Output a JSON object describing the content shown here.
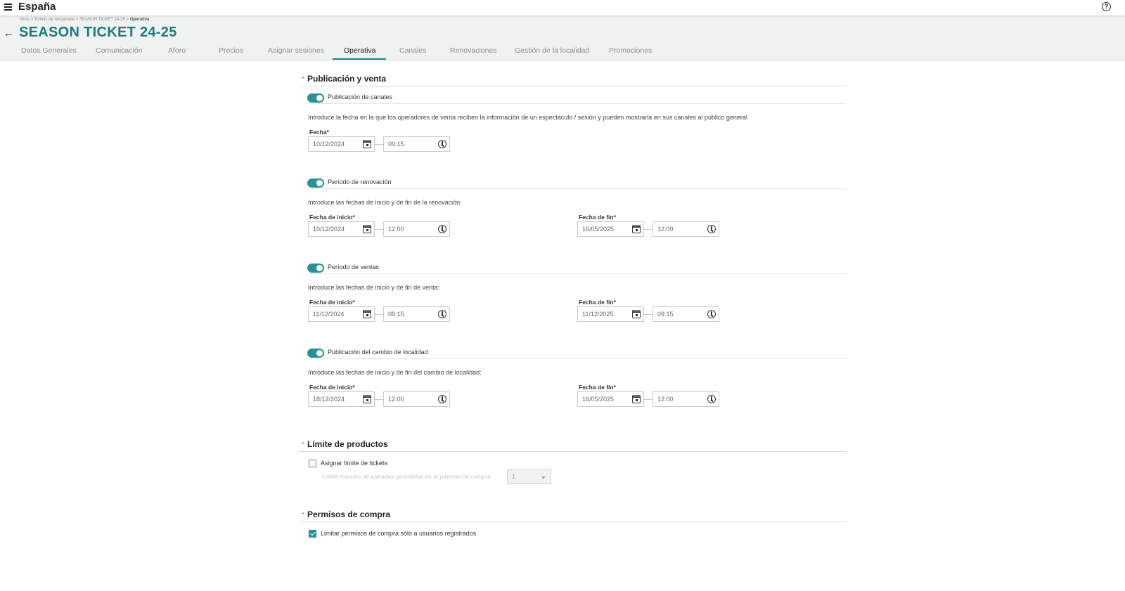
{
  "app": {
    "title": "España"
  },
  "breadcrumb": {
    "trail": "Inicio > Tickets de temporada > SEASON TICKET 24-25 > ",
    "current": "Operativa"
  },
  "page": {
    "title": "SEASON TICKET 24-25"
  },
  "tabs": [
    {
      "label": "Datos Generales",
      "active": false
    },
    {
      "label": "Comunicación",
      "active": false
    },
    {
      "label": "Aforo",
      "active": false
    },
    {
      "label": "Precios",
      "active": false
    },
    {
      "label": "Asignar sesiones",
      "active": false
    },
    {
      "label": "Operativa",
      "active": true
    },
    {
      "label": "Canales",
      "active": false
    },
    {
      "label": "Renovaciones",
      "active": false
    },
    {
      "label": "Gestión de la localidad",
      "active": false
    },
    {
      "label": "Promociones",
      "active": false
    }
  ],
  "sections": {
    "publicacion": {
      "title": "Publicación y venta",
      "canales": {
        "toggle_label": "Publicación de canales",
        "enabled": true,
        "description": "Introduce la fecha en la que los operadores de venta reciben la información de un espectáculo / sesión y pueden mostrarla en sus canales al público general",
        "fecha_label": "Fecha*",
        "date": "10/12/2024",
        "time": "09:15"
      },
      "renovacion": {
        "toggle_label": "Período de renovación",
        "enabled": true,
        "description": "Introduce las fechas de inicio y de fin de la renovación:",
        "start_label": "Fecha de inicio*",
        "start_date": "10/12/2024",
        "start_time": "12:00",
        "end_label": "Fecha de fin*",
        "end_date": "16/05/2025",
        "end_time": "12:00"
      },
      "ventas": {
        "toggle_label": "Período de ventas",
        "enabled": true,
        "description": "Introduce las fechas de inicio y de fin de venta:",
        "start_label": "Fecha de inicio*",
        "start_date": "11/12/2024",
        "start_time": "09:15",
        "end_label": "Fecha de fin*",
        "end_date": "11/12/2025",
        "end_time": "09:15"
      },
      "cambio": {
        "toggle_label": "Publicación del cambio de localidad",
        "enabled": true,
        "description": "Introduce las fechas de inicio y de fin del cambio de localidad:",
        "start_label": "Fecha de inicio*",
        "start_date": "18/12/2024",
        "start_time": "12:00",
        "end_label": "Fecha de fin*",
        "end_date": "16/05/2025",
        "end_time": "12:00"
      }
    },
    "limite": {
      "title": "Límite de productos",
      "checkbox_label": "Asignar límite de tickets",
      "checked": false,
      "max_label": "Límite máximo de entradas permitidas en el proceso de compra",
      "max_value": "1"
    },
    "permisos": {
      "title": "Permisos de compra",
      "checkbox_label": "Limitar permisos de compra sólo a usuarios registrados",
      "checked": true
    }
  },
  "colors": {
    "accent": "#1b7a80",
    "toggle_on": "#2a8f96"
  }
}
